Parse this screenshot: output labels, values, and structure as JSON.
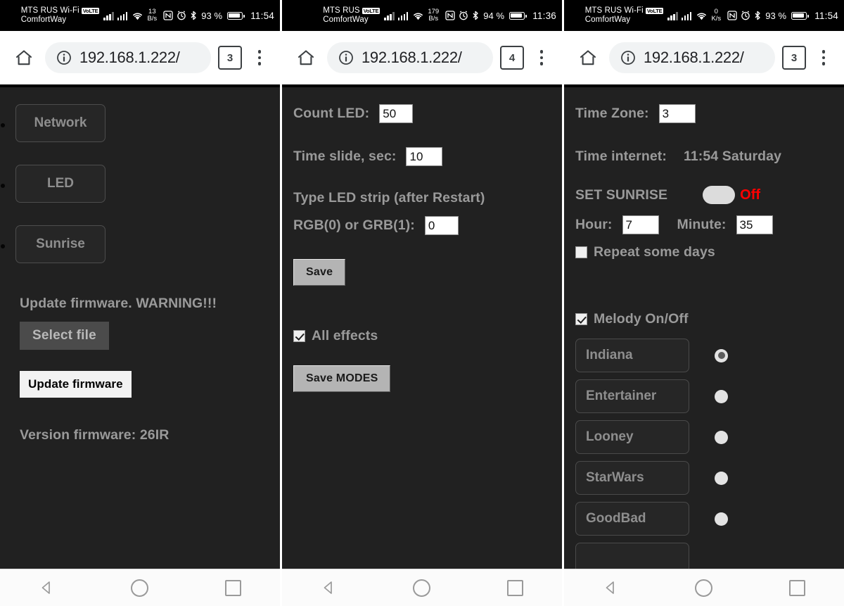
{
  "device": {
    "url": "192.168.1.222/",
    "carrier_line2": "ComfortWay",
    "volte_badge": "VoLTE"
  },
  "screens": [
    {
      "id": "network-screen",
      "status": {
        "carrier": "MTS RUS Wi-Fi",
        "carrier_line2": "ComfortWay",
        "volte": "VoLTE",
        "rate_value": "13",
        "rate_unit": "B/s",
        "battery_pct": "93 %",
        "clock": "11:54"
      },
      "browser": {
        "url": "192.168.1.222/",
        "tab_count": "3"
      },
      "nav_buttons": [
        {
          "label": "Network"
        },
        {
          "label": "LED"
        },
        {
          "label": "Sunrise"
        }
      ],
      "firmware": {
        "warning": "Update firmware. WARNING!!!",
        "select_file": "Select file",
        "update_button": "Update firmware",
        "version": "Version firmware: 26IR"
      }
    },
    {
      "id": "led-screen",
      "status": {
        "carrier": "MTS RUS",
        "carrier_line2": "ComfortWay",
        "volte": "VoLTE",
        "rate_value": "179",
        "rate_unit": "B/s",
        "battery_pct": "94 %",
        "clock": "11:36"
      },
      "browser": {
        "url": "192.168.1.222/",
        "tab_count": "4"
      },
      "form": {
        "count_led_label": "Count LED:",
        "count_led_value": "50",
        "time_slide_label": "Time slide, sec:",
        "time_slide_value": "10",
        "type_strip_header": "Type LED strip (after Restart)",
        "rgb_grb_label": "RGB(0) or GRB(1):",
        "rgb_grb_value": "0",
        "save_label": "Save",
        "all_effects_label": "All effects",
        "all_effects_checked": true,
        "save_modes_label": "Save MODES"
      }
    },
    {
      "id": "sunrise-screen",
      "status": {
        "carrier": "MTS RUS Wi-Fi",
        "carrier_line2": "ComfortWay",
        "volte": "VoLTE",
        "rate_value": "0",
        "rate_unit": "K/s",
        "battery_pct": "93 %",
        "clock": "11:54"
      },
      "browser": {
        "url": "192.168.1.222/",
        "tab_count": "3"
      },
      "sunrise": {
        "time_zone_label": "Time Zone:",
        "time_zone_value": "3",
        "time_internet_label": "Time internet:",
        "time_internet_value": "11:54 Saturday",
        "set_sunrise_label": "SET SUNRISE",
        "toggle_state": "Off",
        "toggle_color": "#ff0000",
        "hour_label": "Hour:",
        "hour_value": "7",
        "minute_label": "Minute:",
        "minute_value": "35",
        "repeat_label": "Repeat some days",
        "repeat_checked": false,
        "melody_label": "Melody On/Off",
        "melody_checked": true,
        "melodies": [
          {
            "name": "Indiana",
            "selected": true
          },
          {
            "name": "Entertainer",
            "selected": false
          },
          {
            "name": "Looney",
            "selected": false
          },
          {
            "name": "StarWars",
            "selected": false
          },
          {
            "name": "GoodBad",
            "selected": false
          }
        ]
      }
    }
  ],
  "navbar": {
    "back": "back-button",
    "home": "home-button",
    "recents": "recents-button"
  },
  "colors": {
    "page_bg": "#212121",
    "text": "#9a9a9a",
    "accent_red": "#ff0000",
    "status_bar": "#000000"
  }
}
